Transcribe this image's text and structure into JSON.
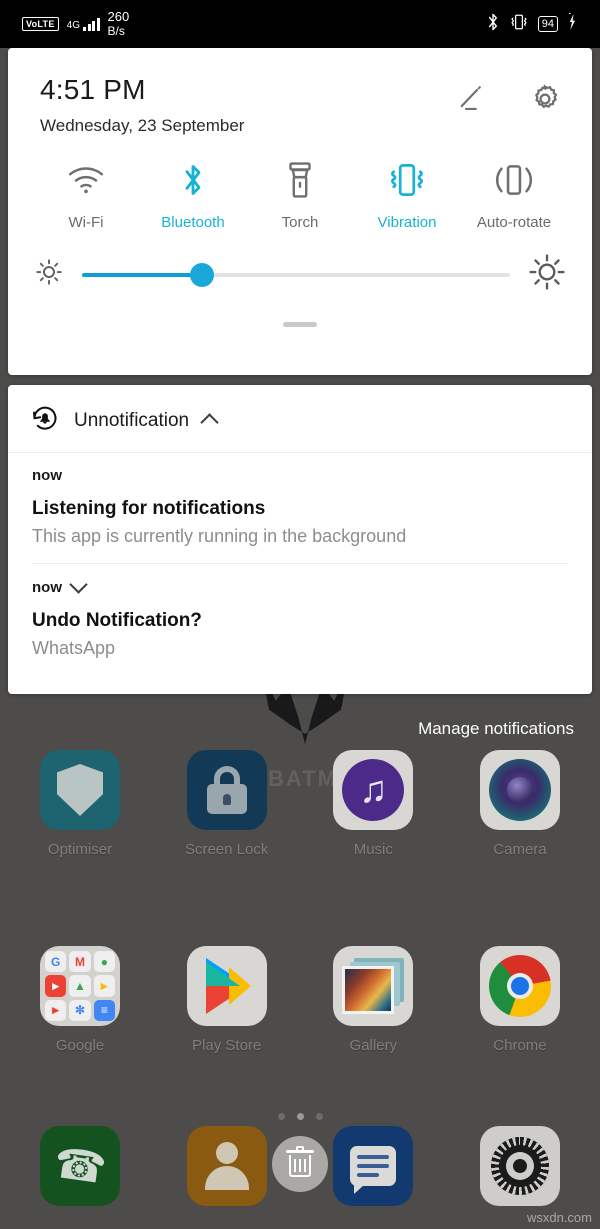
{
  "status_bar": {
    "volte": "VoLTE",
    "network_type": "4G",
    "signal_bars": 4,
    "net_speed_value": "260",
    "net_speed_unit": "B/s",
    "bluetooth_icon": "bluetooth-icon",
    "vibrate_icon": "vibrate-icon",
    "battery_level": "94",
    "charging_icon": "charging-bolt-icon"
  },
  "quick_settings": {
    "time": "4:51 PM",
    "date": "Wednesday, 23 September",
    "edit_icon": "pencil-icon",
    "settings_icon": "gear-icon",
    "accent_color": "#18b2d4",
    "toggles": [
      {
        "label": "Wi-Fi",
        "icon": "wifi-icon",
        "active": false
      },
      {
        "label": "Bluetooth",
        "icon": "bluetooth-icon",
        "active": true
      },
      {
        "label": "Torch",
        "icon": "flashlight-icon",
        "active": false
      },
      {
        "label": "Vibration",
        "icon": "vibrate-icon",
        "active": true
      },
      {
        "label": "Auto-rotate",
        "icon": "rotate-icon",
        "active": false
      }
    ],
    "brightness": {
      "low_icon": "brightness-low-icon",
      "high_icon": "brightness-high-icon",
      "value_percent": 28
    },
    "drag_handle": "panel-drag-handle"
  },
  "notifications": {
    "app_icon": "undo-bell-icon",
    "app_name": "Unnotification",
    "collapse_icon": "chevron-up-icon",
    "items": [
      {
        "when": "now",
        "title": "Listening for notifications",
        "body": "This app is currently running in the background",
        "expand_icon": ""
      },
      {
        "when": "now",
        "title": "Undo Notification?",
        "body": "WhatsApp",
        "expand_icon": "chevron-down-icon"
      }
    ],
    "manage_label": "Manage notifications"
  },
  "home_screen": {
    "wallpaper_text": "BATM",
    "rows": [
      [
        {
          "label": "Optimiser",
          "icon": "shield-icon"
        },
        {
          "label": "Screen Lock",
          "icon": "padlock-icon"
        },
        {
          "label": "Music",
          "icon": "music-note-icon"
        },
        {
          "label": "Camera",
          "icon": "camera-lens-icon"
        }
      ],
      [
        {
          "label": "Google",
          "icon": "google-folder-icon"
        },
        {
          "label": "Play Store",
          "icon": "play-store-icon"
        },
        {
          "label": "Gallery",
          "icon": "gallery-icon"
        },
        {
          "label": "Chrome",
          "icon": "chrome-icon"
        }
      ]
    ],
    "google_folder_items": [
      "G",
      "M",
      "9",
      "▶",
      "△",
      "▷",
      "▶",
      "✳",
      "≡"
    ],
    "page_dots": {
      "count": 3,
      "active_index": 1
    },
    "dock": [
      {
        "label": "Phone",
        "icon": "phone-icon"
      },
      {
        "label": "Contacts",
        "icon": "contacts-icon"
      },
      {
        "label": "Messages",
        "icon": "messages-icon"
      },
      {
        "label": "Settings",
        "icon": "settings-gear-icon"
      }
    ],
    "trash_overlay_icon": "trash-icon"
  },
  "watermark": "wsxdn.com"
}
